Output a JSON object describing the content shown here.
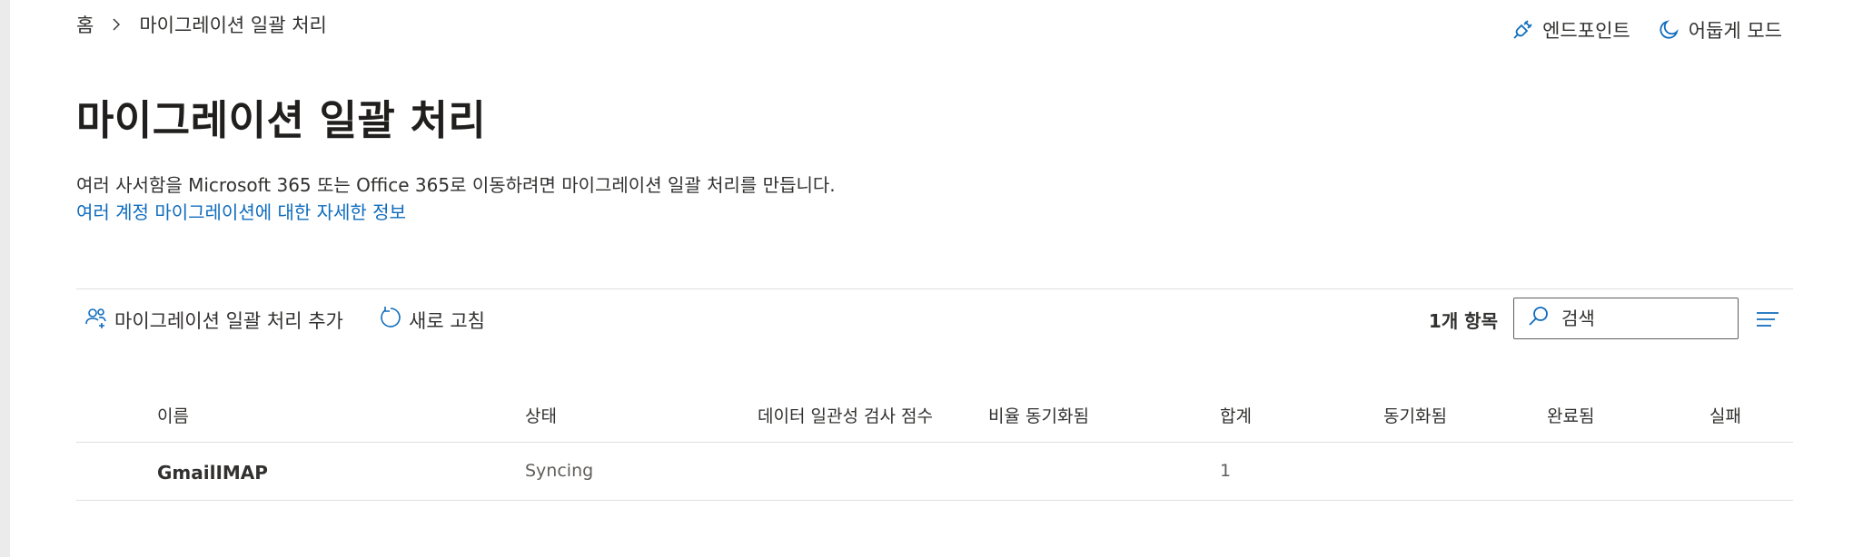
{
  "breadcrumb": {
    "home": "홈",
    "current": "마이그레이션 일괄 처리"
  },
  "top_actions": {
    "endpoints": "엔드포인트",
    "dark_mode": "어둡게 모드"
  },
  "page": {
    "title": "마이그레이션 일괄 처리",
    "description": "여러 사서함을 Microsoft 365 또는 Office 365로 이동하려면 마이그레이션 일괄 처리를 만듭니다.",
    "learn_more": "여러 계정 마이그레이션에 대한 자세한 정보"
  },
  "toolbar": {
    "add_batch": "마이그레이션 일괄 처리 추가",
    "refresh": "새로 고침",
    "item_count": "1개 항목",
    "search_placeholder": "검색"
  },
  "table": {
    "columns": [
      "이름",
      "상태",
      "데이터 일관성 검사 점수",
      "비율 동기화됨",
      "합계",
      "동기화됨",
      "완료됨",
      "실패"
    ],
    "rows": [
      {
        "name": "GmailIMAP",
        "status": "Syncing",
        "data_consistency": "",
        "percent_synced": "",
        "total": "1",
        "synced": "",
        "completed": "",
        "failed": ""
      }
    ]
  },
  "colors": {
    "accent": "#0f6cbd",
    "text": "#323130",
    "divider": "#e1dfdd"
  },
  "icons": {
    "breadcrumb_separator": "chevron-right-icon",
    "endpoints": "plug-icon",
    "dark_mode": "moon-icon",
    "add_batch": "add-people-icon",
    "refresh": "refresh-icon",
    "search": "search-icon",
    "filter": "filter-lines-icon"
  }
}
